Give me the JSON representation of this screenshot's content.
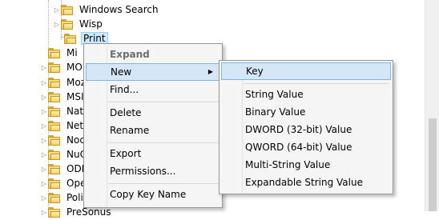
{
  "tree": {
    "children_of_parent": [
      {
        "label": "Windows Search",
        "expander": "collapsed"
      },
      {
        "label": "Wisp",
        "expander": "collapsed"
      },
      {
        "label": "Print",
        "expander": "none",
        "selected": true
      }
    ],
    "siblings": [
      {
        "label": "Mi",
        "expander": "none"
      },
      {
        "label": "MO",
        "expander": "collapsed"
      },
      {
        "label": "Moz",
        "expander": "collapsed"
      },
      {
        "label": "MSI",
        "expander": "collapsed"
      },
      {
        "label": "Nati",
        "expander": "collapsed"
      },
      {
        "label": "Nets",
        "expander": "collapsed"
      },
      {
        "label": "Noc",
        "expander": "collapsed"
      },
      {
        "label": "NuC",
        "expander": "collapsed"
      },
      {
        "label": "ODE",
        "expander": "collapsed"
      },
      {
        "label": "Ope",
        "expander": "collapsed"
      },
      {
        "label": "Poli",
        "expander": "collapsed"
      },
      {
        "label": "PreSonus",
        "expander": "collapsed"
      }
    ]
  },
  "context_menu": {
    "items": [
      {
        "label": "Expand",
        "state": "disabled"
      },
      {
        "label": "New",
        "state": "hover",
        "submenu": "▶"
      },
      {
        "label": "Find..."
      },
      {
        "label": "Delete"
      },
      {
        "label": "Rename"
      },
      {
        "label": "Export"
      },
      {
        "label": "Permissions..."
      },
      {
        "label": "Copy Key Name"
      }
    ]
  },
  "new_submenu": {
    "items": [
      {
        "label": "Key",
        "state": "hover"
      },
      {
        "label": "String Value"
      },
      {
        "label": "Binary Value"
      },
      {
        "label": "DWORD (32-bit) Value"
      },
      {
        "label": "QWORD (64-bit) Value"
      },
      {
        "label": "Multi-String Value"
      },
      {
        "label": "Expandable String Value"
      }
    ]
  },
  "icons": {
    "expander": "chevron-right-icon",
    "folder": "folder-icon",
    "submenu_arrow": "submenu-arrow-icon"
  },
  "colors": {
    "selection": "#cce8ff",
    "menu_hover": "#d5e6f7",
    "menu_background": "#f5f5f5"
  }
}
